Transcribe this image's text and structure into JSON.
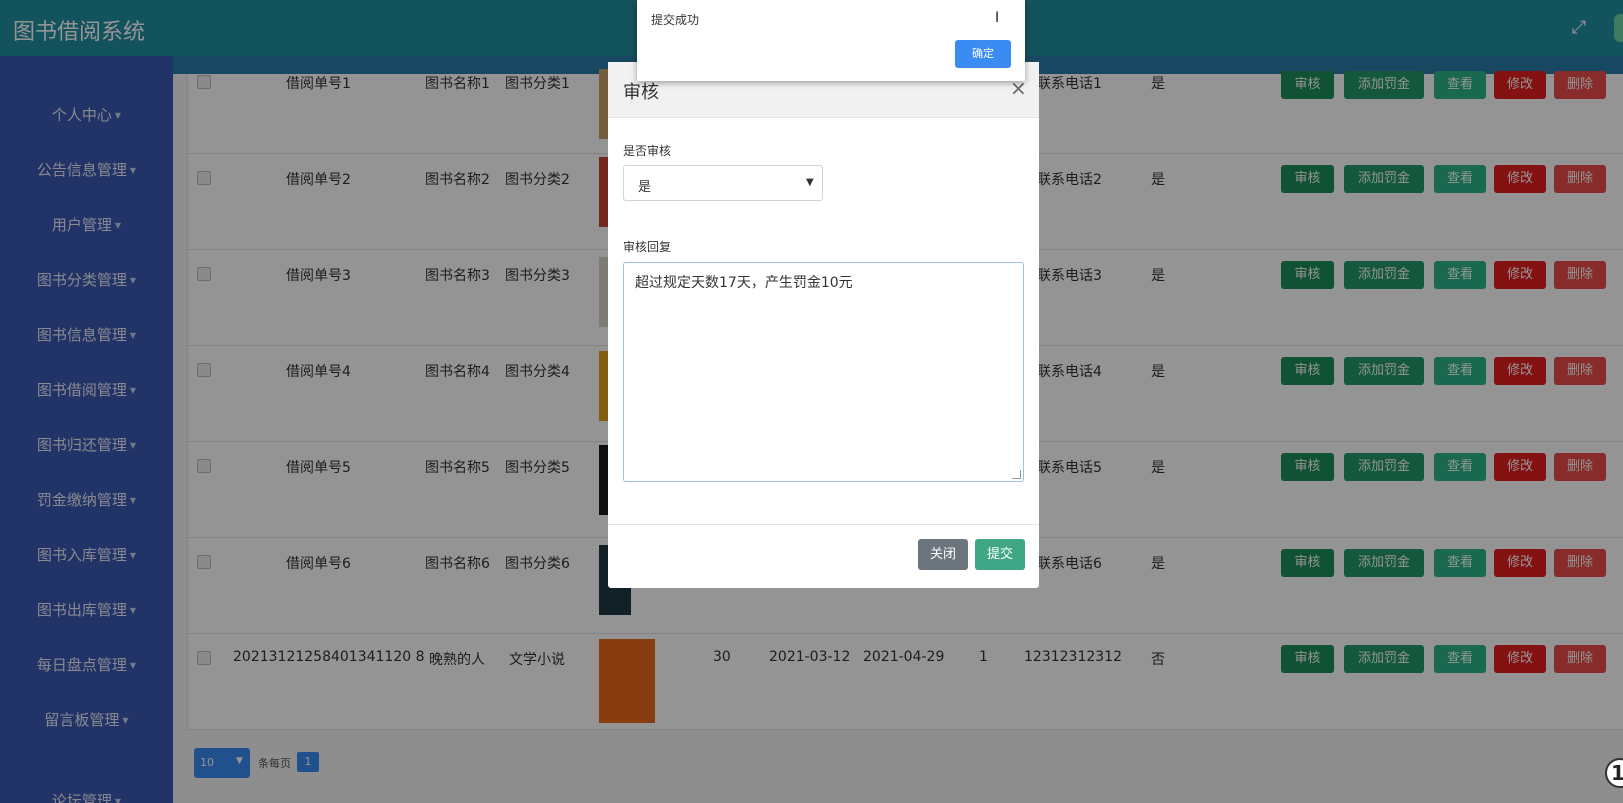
{
  "app": {
    "title": "图书借阅系统"
  },
  "sidebar": {
    "items": [
      {
        "label": "个人中心"
      },
      {
        "label": "公告信息管理"
      },
      {
        "label": "用户管理"
      },
      {
        "label": "图书分类管理"
      },
      {
        "label": "图书信息管理"
      },
      {
        "label": "图书借阅管理"
      },
      {
        "label": "图书归还管理"
      },
      {
        "label": "罚金缴纳管理"
      },
      {
        "label": "图书入库管理"
      },
      {
        "label": "图书出库管理"
      },
      {
        "label": "每日盘点管理"
      },
      {
        "label": "留言板管理"
      },
      {
        "label": "论坛管理"
      }
    ]
  },
  "table": {
    "rows": [
      {
        "order": "借阅单号1",
        "book": "图书名称1",
        "category": "图书分类1",
        "phone": "联系电话1",
        "audited": "是",
        "cover": "#c9a26a"
      },
      {
        "order": "借阅单号2",
        "book": "图书名称2",
        "category": "图书分类2",
        "phone": "联系电话2",
        "audited": "是",
        "cover": "#c8452f"
      },
      {
        "order": "借阅单号3",
        "book": "图书名称3",
        "category": "图书分类3",
        "phone": "联系电话3",
        "audited": "是",
        "cover": "#d9d4c8"
      },
      {
        "order": "借阅单号4",
        "book": "图书名称4",
        "category": "图书分类4",
        "phone": "联系电话4",
        "audited": "是",
        "cover": "#e0a21a"
      },
      {
        "order": "借阅单号5",
        "book": "图书名称5",
        "category": "图书分类5",
        "phone": "联系电话5",
        "audited": "是",
        "cover": "#1a1a1a"
      },
      {
        "order": "借阅单号6",
        "book": "图书名称6",
        "category": "图书分类6",
        "phone": "联系电话6",
        "audited": "是",
        "cover": "#1f3846"
      },
      {
        "order": "20213121258401341120 8",
        "book": "晚熟的人",
        "category": "文学小说",
        "qty": "30",
        "borrow_date": "2021-03-12",
        "return_date": "2021-04-29",
        "days": "1",
        "phone": "12312312312",
        "audited": "否",
        "cover": "#e86a1c"
      }
    ],
    "buttons": {
      "audit": "审核",
      "fine": "添加罚金",
      "view": "查看",
      "edit": "修改",
      "delete": "删除"
    }
  },
  "pager": {
    "page_size": "10",
    "per_page_text": "条每页",
    "current_page": "1"
  },
  "modal": {
    "title": "审核",
    "close_symbol": "×",
    "audit_label": "是否审核",
    "audit_value": "是",
    "reply_label": "审核回复",
    "reply_value": "超过规定天数17天，产生罚金10元",
    "close_button": "关闭",
    "submit_button": "提交"
  },
  "alert": {
    "message": "提交成功",
    "ok_button": "确定"
  },
  "colors": {
    "header": "#1f8fa3",
    "sidebar": "#3c58b4",
    "primary": "#3a8cf3",
    "danger": "#e62020",
    "success": "#1e8e5a"
  }
}
